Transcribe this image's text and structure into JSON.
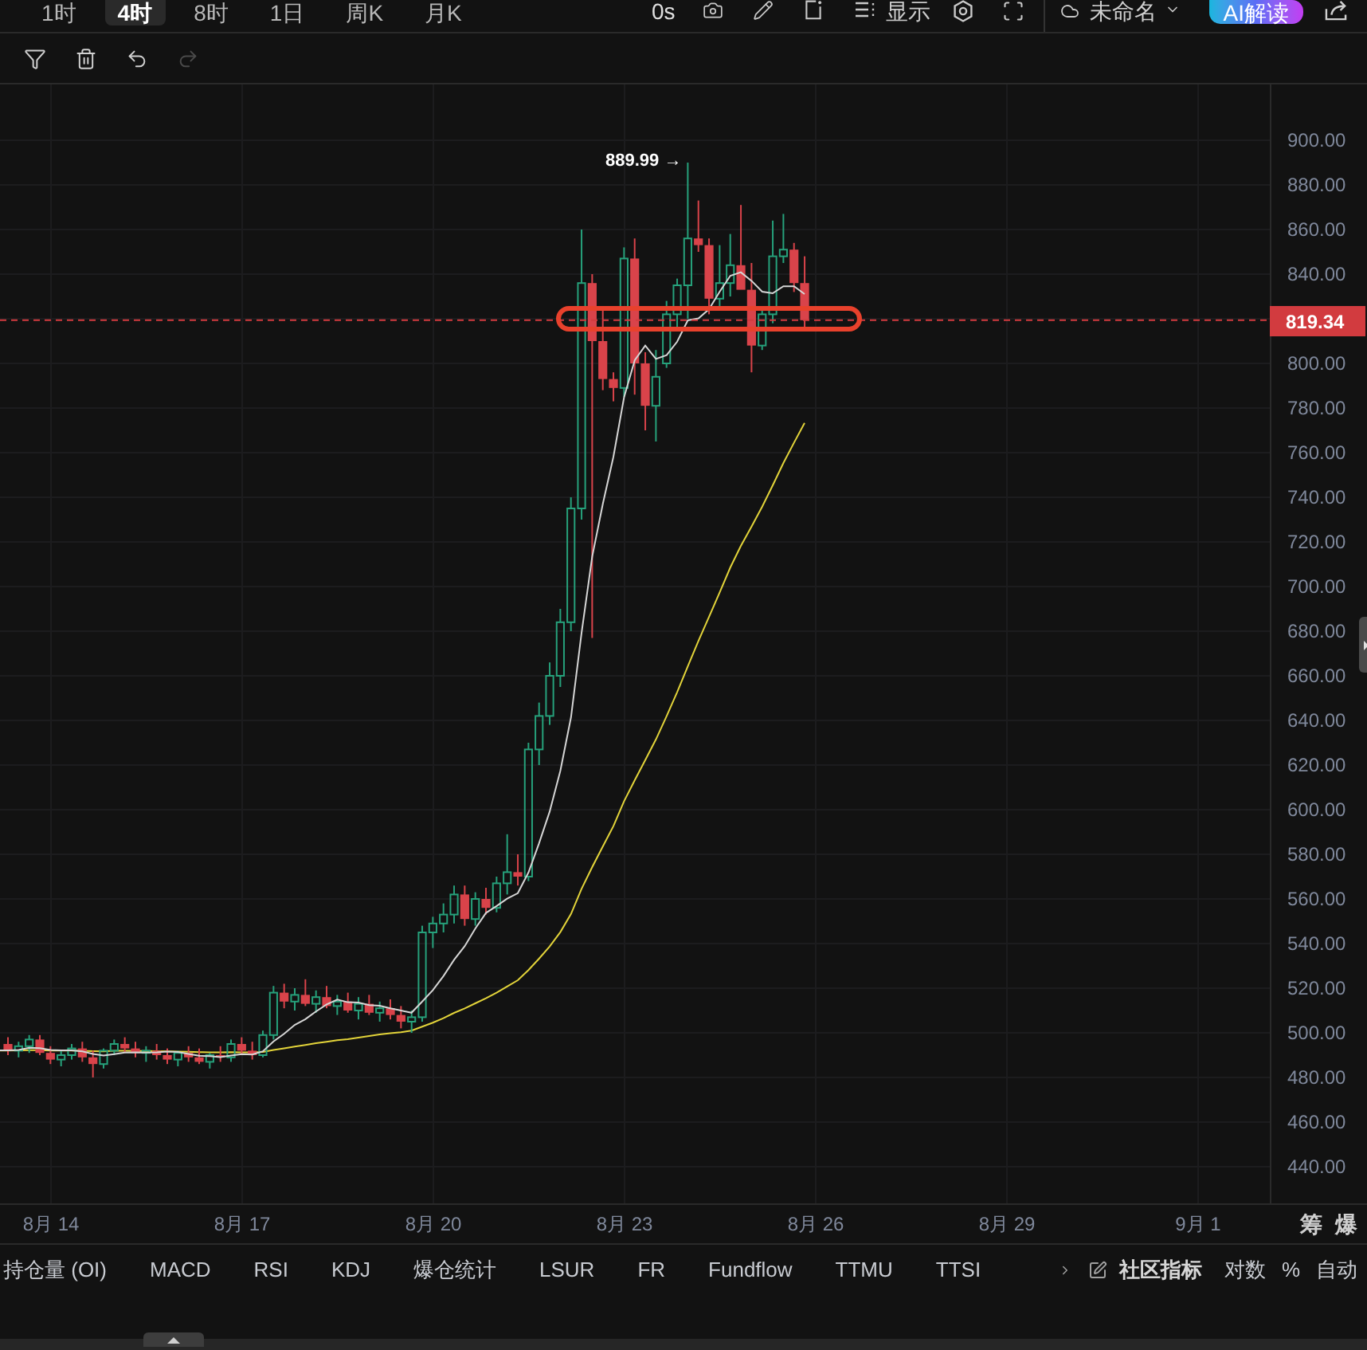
{
  "top_bar": {
    "intervals": [
      {
        "label": "1时",
        "selected": false
      },
      {
        "label": "4时",
        "selected": true
      },
      {
        "label": "8时",
        "selected": false
      },
      {
        "label": "1日",
        "selected": false
      },
      {
        "label": "周K",
        "selected": false
      },
      {
        "label": "月K",
        "selected": false
      }
    ],
    "countdown": "0s",
    "display_button": "显示",
    "layout_name": "未命名",
    "ai_button": "AI解读"
  },
  "drawing_tools": [
    {
      "kind": "filter",
      "disabled": false
    },
    {
      "kind": "delete",
      "disabled": false
    },
    {
      "kind": "undo",
      "disabled": false
    },
    {
      "kind": "redo",
      "disabled": true
    }
  ],
  "chart": {
    "high_label": "889.99 →",
    "price_axis": {
      "above_last_price": [
        "900.00",
        "880.00",
        "860.00",
        "840.00"
      ],
      "last_price": "819.34",
      "below_last_price": [
        "800.00",
        "780.00",
        "760.00",
        "740.00",
        "720.00",
        "700.00",
        "680.00",
        "660.00",
        "640.00",
        "620.00",
        "600.00",
        "580.00",
        "560.00",
        "540.00",
        "520.00",
        "500.00",
        "480.00",
        "460.00",
        "440.00"
      ]
    },
    "date_axis": [
      "8月 14",
      "8月 17",
      "8月 20",
      "8月 23",
      "8月 26",
      "8月 29",
      "9月 1"
    ],
    "side_tabs": [
      "筹",
      "爆"
    ]
  },
  "indicator_bar": {
    "indicators": [
      "持仓量 (OI)",
      "MACD",
      "RSI",
      "KDJ",
      "爆仓统计",
      "LSUR",
      "FR",
      "Fundflow",
      "TTMU",
      "TTSI"
    ],
    "community_label": "社区指标",
    "options": [
      "对数",
      "%",
      "自动"
    ]
  }
}
